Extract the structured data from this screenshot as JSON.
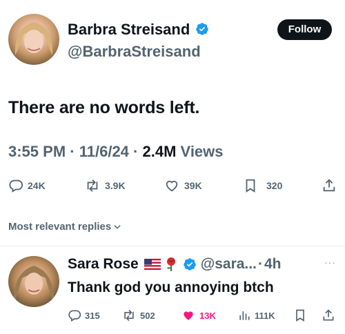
{
  "tweet": {
    "author_name": "Barbra Streisand",
    "handle": "@BarbraStreisand",
    "follow_label": "Follow",
    "text": "There are no words left.",
    "time": "3:55 PM",
    "sep1": "·",
    "date": "11/6/24",
    "sep2": "·",
    "views_count": "2.4M",
    "views_label": "Views",
    "stats": {
      "replies": "24K",
      "reposts": "3.9K",
      "likes": "39K",
      "bookmarks": "320"
    }
  },
  "replies_filter": {
    "label": "Most relevant replies"
  },
  "reply": {
    "author_name": "Sara Rose",
    "handle": "@sara...",
    "sep": "·",
    "time": "4h",
    "text": "Thank god you annoying btch",
    "stats": {
      "replies": "315",
      "reposts": "502",
      "likes": "13K",
      "views": "111K"
    }
  },
  "colors": {
    "verified": "#1d9bf0",
    "liked": "#f91880",
    "text": "#0f1419",
    "muted": "#536471"
  }
}
